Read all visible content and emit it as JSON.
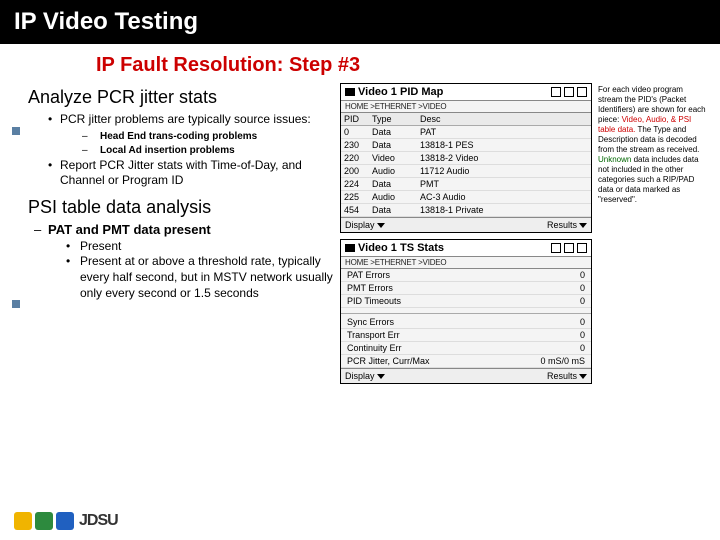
{
  "header": {
    "title": "IP Video Testing"
  },
  "subtitle": "IP Fault Resolution: Step #3",
  "section1": {
    "heading": "Analyze PCR jitter stats",
    "b1": "PCR jitter problems are typically source issues:",
    "b1a": "Head End trans-coding problems",
    "b1b": "Local Ad insertion problems",
    "b2": "Report PCR Jitter stats with Time-of-Day, and Channel or Program ID"
  },
  "section2": {
    "heading": "PSI table data analysis",
    "d1": "PAT and PMT data present",
    "c1": "Present",
    "c2": "Present at or above a threshold rate, typically every half second, but in MSTV network usually only every second or 1.5 seconds"
  },
  "panel1": {
    "title": "Video 1 PID Map",
    "path": "HOME >ETHERNET >VIDEO",
    "cols": [
      "PID",
      "Type",
      "Desc"
    ],
    "rows": [
      [
        "0",
        "Data",
        "PAT"
      ],
      [
        "230",
        "Data",
        "13818-1 PES"
      ],
      [
        "220",
        "Video",
        "13818-2 Video"
      ],
      [
        "200",
        "Audio",
        "11712 Audio"
      ],
      [
        "224",
        "Data",
        "PMT"
      ],
      [
        "225",
        "Audio",
        "AC-3 Audio"
      ],
      [
        "454",
        "Data",
        "13818-1 Private"
      ]
    ],
    "foot_l": "Display",
    "foot_r": "Results"
  },
  "panel2": {
    "title": "Video 1 TS Stats",
    "path": "HOME >ETHERNET >VIDEO",
    "rows1": [
      [
        "PAT Errors",
        "0"
      ],
      [
        "PMT Errors",
        "0"
      ],
      [
        "PID Timeouts",
        "0"
      ]
    ],
    "rows2": [
      [
        "Sync Errors",
        "0"
      ],
      [
        "Transport Err",
        "0"
      ],
      [
        "Continuity Err",
        "0"
      ],
      [
        "PCR Jitter, Curr/Max",
        "0 mS/0 mS"
      ]
    ],
    "foot_l": "Display",
    "foot_r": "Results"
  },
  "sidenote": {
    "p1a": "For each video program stream the PID's (Packet Identifiers) are shown for each piece: ",
    "p1b": "Video, Audio, & PSI table data.",
    "p1c": " The Type and Description data is decoded from the stream as received. ",
    "p1d": "Unknown",
    "p1e": " data includes data not included in the other categories such a RIP/PAD data or data marked as \"reserved\"."
  },
  "logo": {
    "text": "JDSU"
  }
}
